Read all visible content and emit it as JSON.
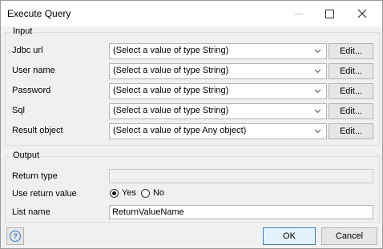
{
  "window": {
    "title": "Execute Query",
    "min_icon": "minimize-icon",
    "max_icon": "maximize-icon",
    "close_icon": "close-icon"
  },
  "input": {
    "legend": "Input",
    "edit_label": "Edit...",
    "rows": [
      {
        "label": "Jdbc url",
        "value": "(Select a value of type String)"
      },
      {
        "label": "User name",
        "value": "(Select a value of type String)"
      },
      {
        "label": "Password",
        "value": "(Select a value of type String)"
      },
      {
        "label": "Sql",
        "value": "(Select a value of type String)"
      },
      {
        "label": "Result object",
        "value": "(Select a value of type Any object)"
      }
    ]
  },
  "output": {
    "legend": "Output",
    "return_type_label": "Return type",
    "return_type_value": "",
    "use_return_label": "Use return value",
    "yes_label": "Yes",
    "no_label": "No",
    "use_return_selected": "Yes",
    "list_name_label": "List name",
    "list_name_value": "ReturnValueName"
  },
  "footer": {
    "help_glyph": "?",
    "ok_label": "OK",
    "cancel_label": "Cancel"
  },
  "colors": {
    "dialog_bg": "#f0f0f0",
    "ok_border": "#3c7fb1",
    "help_icon": "#3a78c2"
  }
}
